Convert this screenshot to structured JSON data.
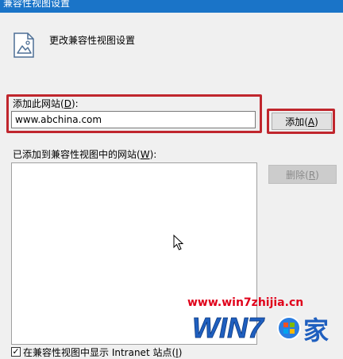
{
  "window": {
    "title": "兼容性视图设置"
  },
  "header": {
    "title": "更改兼容性视图设置"
  },
  "add_site": {
    "label": "添加此网站(D):",
    "value": "www.abchina.com",
    "button": "添加(A)"
  },
  "site_list": {
    "label": "已添加到兼容性视图中的网站(W):",
    "items": [],
    "remove_button": "删除(R)"
  },
  "options": {
    "intranet": {
      "label": "在兼容性视图中显示 Intranet 站点(I)",
      "checked": true
    }
  },
  "watermark": {
    "url": "www.win7zhijia.cn",
    "logo_text": "WIN7",
    "logo_suffix": "家"
  },
  "colors": {
    "title_bar": "#1a74c8",
    "highlight": "#c0262d",
    "watermark": "#e0001a"
  }
}
